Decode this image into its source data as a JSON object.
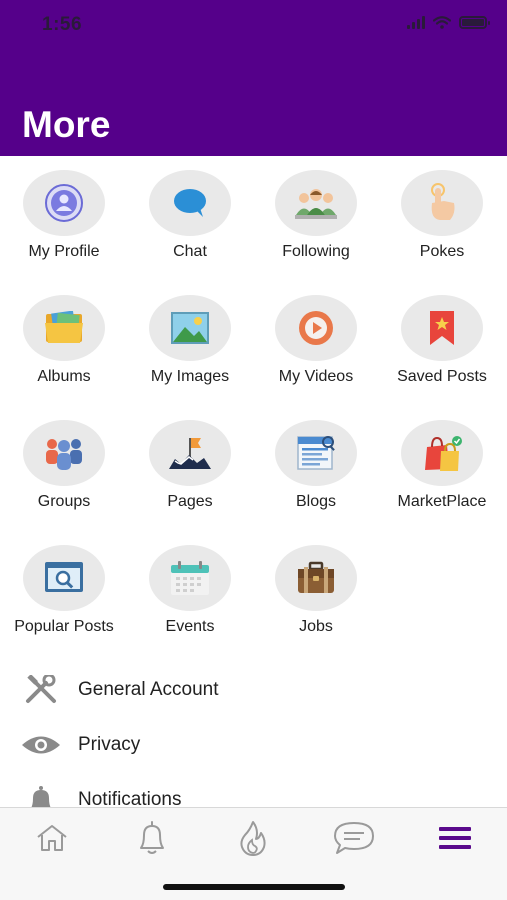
{
  "status_bar": {
    "time": "1:56"
  },
  "header": {
    "title": "More"
  },
  "grid": [
    {
      "label": "My Profile",
      "icon": "profile-icon"
    },
    {
      "label": "Chat",
      "icon": "chat-bubble-icon"
    },
    {
      "label": "Following",
      "icon": "people-group-icon"
    },
    {
      "label": "Pokes",
      "icon": "poke-hand-icon"
    },
    {
      "label": "Albums",
      "icon": "folder-photos-icon"
    },
    {
      "label": "My Images",
      "icon": "image-icon"
    },
    {
      "label": "My Videos",
      "icon": "video-play-icon"
    },
    {
      "label": "Saved Posts",
      "icon": "bookmark-star-icon"
    },
    {
      "label": "Groups",
      "icon": "groups-icon"
    },
    {
      "label": "Pages",
      "icon": "flag-icon"
    },
    {
      "label": "Blogs",
      "icon": "blog-icon"
    },
    {
      "label": "MarketPlace",
      "icon": "shopping-bag-icon"
    },
    {
      "label": "Popular Posts",
      "icon": "search-window-icon"
    },
    {
      "label": "Events",
      "icon": "calendar-icon"
    },
    {
      "label": "Jobs",
      "icon": "briefcase-icon"
    }
  ],
  "settings": [
    {
      "label": "General Account",
      "icon": "tools-icon"
    },
    {
      "label": "Privacy",
      "icon": "eye-icon"
    },
    {
      "label": "Notifications",
      "icon": "bell-icon"
    }
  ],
  "tabbar": [
    {
      "name": "home",
      "icon": "home-icon",
      "active": false
    },
    {
      "name": "notifications",
      "icon": "bell-icon",
      "active": false
    },
    {
      "name": "trending",
      "icon": "flame-icon",
      "active": false
    },
    {
      "name": "messages",
      "icon": "chat-icon",
      "active": false
    },
    {
      "name": "more",
      "icon": "menu-icon",
      "active": true
    }
  ],
  "colors": {
    "header": "#55008a",
    "accent": "#5a0a8c",
    "tile_bg": "#e9e9e9",
    "icon_gray": "#9a9a9a"
  }
}
